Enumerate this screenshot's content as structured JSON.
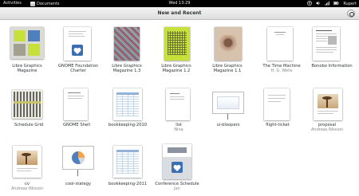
{
  "topbar": {
    "activities": "Activities",
    "app_name": "Documents",
    "clock": "Wed 13:29",
    "user": "Rupert",
    "icons": [
      "accessibility-icon",
      "volume-icon",
      "network-icon",
      "battery-icon"
    ]
  },
  "headerbar": {
    "title": "New and Recent",
    "select_icon": "selection-icon"
  },
  "documents": [
    {
      "label": "Libre Graphics",
      "label2": "Magazine",
      "sub": "",
      "thumb": "lgm-cover"
    },
    {
      "label": "GNOME Foundation",
      "label2": "Charter",
      "sub": "",
      "thumb": "doc-heart"
    },
    {
      "label": "Libre Graphics",
      "label2": "Magazine 1.3",
      "sub": "",
      "thumb": "lgm-13"
    },
    {
      "label": "Libre Graphics",
      "label2": "Magazine 1.2",
      "sub": "",
      "thumb": "lgm-12"
    },
    {
      "label": "Libre Graphics",
      "label2": "Magazine 1.1",
      "sub": "",
      "thumb": "lgm-11"
    },
    {
      "label": "The Time Machine",
      "label2": "",
      "sub": "H. G. Wells",
      "thumb": "text-page"
    },
    {
      "label": "Bonobo Information",
      "label2": "",
      "sub": "",
      "thumb": "bonobo"
    },
    {
      "label": "Schedule Grid",
      "label2": "",
      "sub": "",
      "thumb": "schedule"
    },
    {
      "label": "GNOME Shell",
      "label2": "",
      "sub": "",
      "thumb": "text-page-2"
    },
    {
      "label": "bookkeeping-2010",
      "label2": "",
      "sub": "",
      "thumb": "spreadsheet"
    },
    {
      "label": "list",
      "label2": "",
      "sub": "Nina",
      "thumb": "text-list"
    },
    {
      "label": "ui-bloopers",
      "label2": "",
      "sub": "",
      "thumb": "presentation"
    },
    {
      "label": "flight-ticket",
      "label2": "",
      "sub": "",
      "thumb": "ticket"
    },
    {
      "label": "proposal",
      "label2": "",
      "sub": "Andreas Nilsson",
      "thumb": "proposal"
    },
    {
      "label": "cv",
      "label2": "",
      "sub": "Andreas Nilsson",
      "thumb": "cv"
    },
    {
      "label": "cool-stategy",
      "label2": "",
      "sub": "",
      "thumb": "presentation-pie"
    },
    {
      "label": "bookkeeping-2011",
      "label2": "",
      "sub": "",
      "thumb": "spreadsheet"
    },
    {
      "label": "Conference Schedule",
      "label2": "",
      "sub": "Jan",
      "thumb": "conference"
    }
  ],
  "colors": {
    "lime": "#c8e03a",
    "cover_blue": "#4f7fbf",
    "heart_blue": "#3c6eb4",
    "grey_bg": "#dcdad4"
  }
}
